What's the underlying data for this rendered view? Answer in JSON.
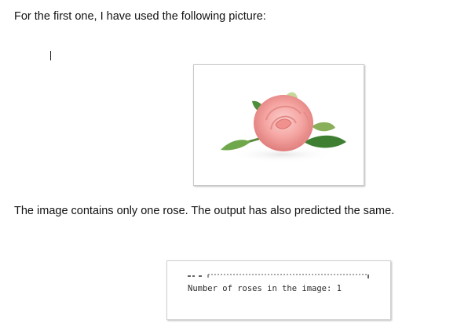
{
  "document": {
    "intro_text": "For the first one, I have used the following picture:",
    "result_text": "The image contains only one rose. The output has also predicted the same.",
    "embedded_image": {
      "subject": "pink rose with green leaves on white background",
      "colors": {
        "petal": "#f5a6a3",
        "petal_dark": "#e07d7b",
        "leaf": "#4e8f3a"
      }
    },
    "console_output": {
      "line": "Number of roses in the image: 1"
    }
  }
}
